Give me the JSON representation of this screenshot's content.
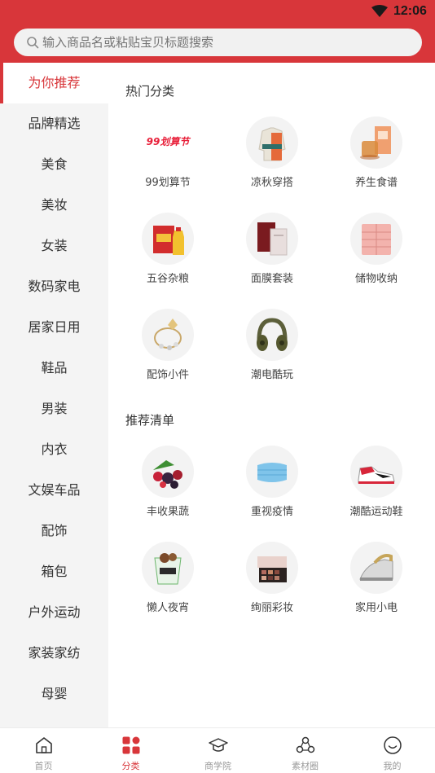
{
  "status": {
    "time": "12:06"
  },
  "search": {
    "placeholder": "输入商品名或粘贴宝贝标题搜索"
  },
  "sidebar": {
    "items": [
      {
        "label": "为你推荐",
        "active": true
      },
      {
        "label": "品牌精选"
      },
      {
        "label": "美食"
      },
      {
        "label": "美妆"
      },
      {
        "label": "女装"
      },
      {
        "label": "数码家电"
      },
      {
        "label": "居家日用"
      },
      {
        "label": "鞋品"
      },
      {
        "label": "男装"
      },
      {
        "label": "内衣"
      },
      {
        "label": "文娱车品"
      },
      {
        "label": "配饰"
      },
      {
        "label": "箱包"
      },
      {
        "label": "户外运动"
      },
      {
        "label": "家装家纺"
      },
      {
        "label": "母婴"
      }
    ]
  },
  "hot": {
    "title": "热门分类",
    "badge_text": "99划算节",
    "items": [
      {
        "label": "99划算节",
        "icon": "99-promo-icon"
      },
      {
        "label": "凉秋穿搭",
        "icon": "jacket-icon"
      },
      {
        "label": "养生食谱",
        "icon": "tea-icon"
      },
      {
        "label": "五谷杂粮",
        "icon": "rice-oil-icon"
      },
      {
        "label": "面膜套装",
        "icon": "face-mask-icon"
      },
      {
        "label": "储物收纳",
        "icon": "drawer-icon"
      },
      {
        "label": "配饰小件",
        "icon": "bracelet-icon"
      },
      {
        "label": "潮电酷玩",
        "icon": "headphones-icon"
      }
    ]
  },
  "recommend": {
    "title": "推荐清单",
    "items": [
      {
        "label": "丰收果蔬",
        "icon": "fruit-icon"
      },
      {
        "label": "重视疫情",
        "icon": "medical-mask-icon"
      },
      {
        "label": "潮酷运动鞋",
        "icon": "sneaker-icon"
      },
      {
        "label": "懒人夜宵",
        "icon": "snack-icon"
      },
      {
        "label": "绚丽彩妆",
        "icon": "eyeshadow-icon"
      },
      {
        "label": "家用小电",
        "icon": "iron-icon"
      }
    ]
  },
  "nav": {
    "items": [
      {
        "label": "首页",
        "icon": "home-icon"
      },
      {
        "label": "分类",
        "icon": "category-icon",
        "active": true
      },
      {
        "label": "商学院",
        "icon": "graduation-cap-icon"
      },
      {
        "label": "素材圈",
        "icon": "material-circle-icon"
      },
      {
        "label": "我的",
        "icon": "profile-icon"
      }
    ]
  },
  "colors": {
    "brand": "#d8363a",
    "active_nav": "#d8363a",
    "sidebar_bg": "#f4f4f4"
  }
}
